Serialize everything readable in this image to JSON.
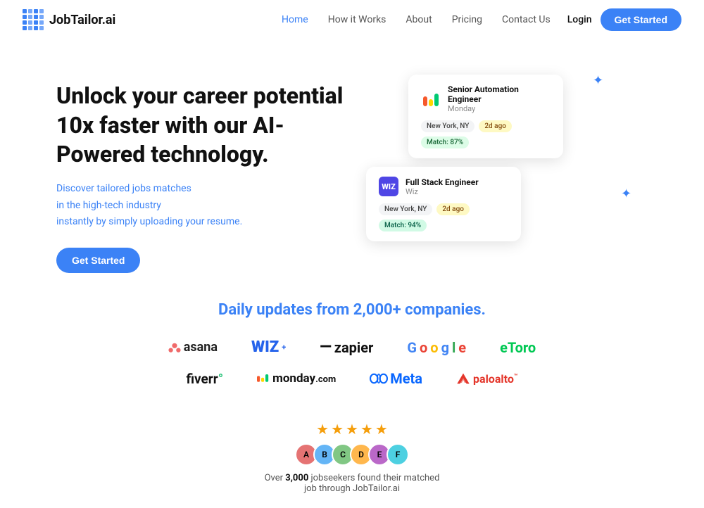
{
  "nav": {
    "logo_text": "JobTailor.ai",
    "links": [
      {
        "label": "Home",
        "active": true
      },
      {
        "label": "How it Works",
        "active": false
      },
      {
        "label": "About",
        "active": false
      },
      {
        "label": "Pricing",
        "active": false
      },
      {
        "label": "Contact Us",
        "active": false
      }
    ],
    "login_label": "Login",
    "cta_label": "Get Started"
  },
  "hero": {
    "title": "Unlock your career potential 10x faster with our AI-Powered technology.",
    "subtitle_line1": "Discover tailored jobs matches",
    "subtitle_line2": "in the high-tech industry",
    "subtitle_line3": "instantly by simply uploading your resume.",
    "cta_label": "Get Started",
    "card1": {
      "title": "Senior Automation Engineer",
      "company": "Monday",
      "tags": {
        "location": "New York, NY",
        "time": "2d ago",
        "match": "Match: 87%"
      }
    },
    "card2": {
      "title": "Full Stack Engineer",
      "company": "Wiz",
      "tags": {
        "location": "New York, NY",
        "time": "2d ago",
        "match": "Match: 94%"
      }
    }
  },
  "daily_section": {
    "text_before": "Daily updates from ",
    "highlight": "2,000+",
    "text_after": " companies."
  },
  "logos_row1": [
    {
      "name": "asana",
      "label": "asana"
    },
    {
      "name": "wiz",
      "label": "WIZ⁺"
    },
    {
      "name": "zapier",
      "label": "—zapier"
    },
    {
      "name": "google",
      "label": "Google"
    },
    {
      "name": "etoro",
      "label": "eToro"
    }
  ],
  "logos_row2": [
    {
      "name": "fiverr",
      "label": "fiverr°"
    },
    {
      "name": "monday",
      "label": "monday.com"
    },
    {
      "name": "meta",
      "label": "Meta"
    },
    {
      "name": "paloalto",
      "label": "paloalto"
    }
  ],
  "social_proof": {
    "stars": 5,
    "avatars": [
      "#e57373",
      "#64b5f6",
      "#81c784",
      "#ffb74d",
      "#ba68c8",
      "#4dd0e1"
    ],
    "text_before": "Over ",
    "count": "3,000",
    "text_mid": " jobseekers found their matched",
    "text_after": "job through JobTailor.ai"
  }
}
